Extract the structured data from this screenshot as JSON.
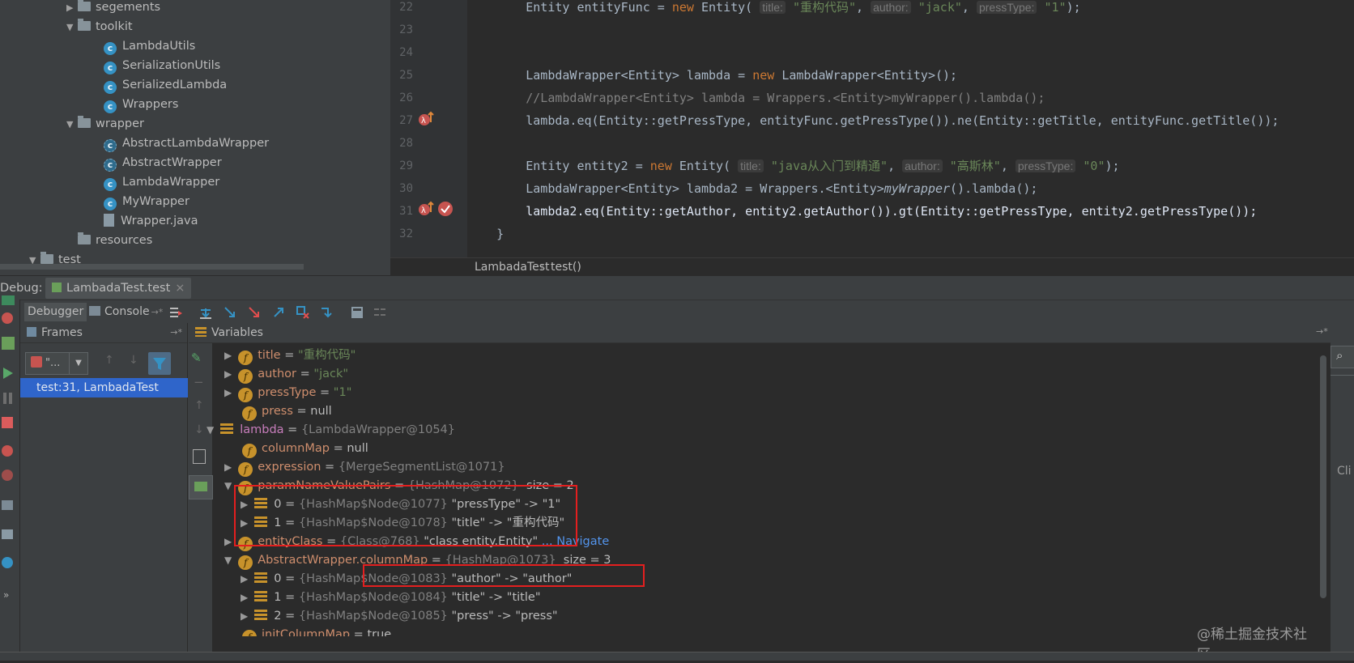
{
  "tree": [
    {
      "label": "segements",
      "type": "folder",
      "expanded": false
    },
    {
      "label": "toolkit",
      "type": "folder",
      "expanded": true
    },
    {
      "label": "LambdaUtils",
      "type": "class"
    },
    {
      "label": "SerializationUtils",
      "type": "class"
    },
    {
      "label": "SerializedLambda",
      "type": "class"
    },
    {
      "label": "Wrappers",
      "type": "class"
    },
    {
      "label": "wrapper",
      "type": "folder",
      "expanded": true
    },
    {
      "label": "AbstractLambdaWrapper",
      "type": "abstract"
    },
    {
      "label": "AbstractWrapper",
      "type": "abstract"
    },
    {
      "label": "LambdaWrapper",
      "type": "class"
    },
    {
      "label": "MyWrapper",
      "type": "class"
    },
    {
      "label": "Wrapper.java",
      "type": "file"
    },
    {
      "label": "resources",
      "type": "folder",
      "expanded": null
    },
    {
      "label": "test",
      "type": "folder",
      "expanded": true
    }
  ],
  "editor": {
    "line_numbers": [
      "22",
      "23",
      "24",
      "25",
      "26",
      "27",
      "28",
      "29",
      "30",
      "31",
      "32"
    ],
    "breadcrumb": {
      "file": "LambadaTest",
      "method": "test()"
    },
    "highlighted_line": "31"
  },
  "debug": {
    "title_label": "Debug:",
    "tab_label": "LambadaTest.test",
    "debugger_tab": "Debugger",
    "console_tab": "Console",
    "frames_label": "Frames",
    "variables_label": "Variables",
    "frame_item": "test:31, LambadaTest",
    "thread_select": "\"...",
    "right_label": "Cli"
  },
  "variables": [
    {
      "name": "title",
      "value": "\"重构代码\""
    },
    {
      "name": "author",
      "value": "\"jack\""
    },
    {
      "name": "pressType",
      "value": "\"1\""
    },
    {
      "name": "press",
      "value": "null"
    },
    {
      "name": "lambda",
      "value": "{LambdaWrapper@1054}"
    },
    {
      "name": "columnMap",
      "value": "null"
    },
    {
      "name": "expression",
      "value": "{MergeSegmentList@1071}"
    },
    {
      "name": "paramNameValuePairs",
      "ref": "{HashMap@1072}",
      "extra": "size = 2"
    },
    {
      "name": "0",
      "ref": "{HashMap$Node@1077}",
      "extra": "\"pressType\" -> \"1\""
    },
    {
      "name": "1",
      "ref": "{HashMap$Node@1078}",
      "extra": "\"title\" -> \"重构代码\""
    },
    {
      "name": "entityClass",
      "ref": "{Class@768}",
      "extra": "\"class entity.Entity\"",
      "link": "... Navigate"
    },
    {
      "name": "AbstractWrapper.columnMap",
      "ref": "{HashMap@1073}",
      "extra": "size = 3"
    },
    {
      "name": "0",
      "ref": "{HashMap$Node@1083}",
      "extra": "\"author\" -> \"author\""
    },
    {
      "name": "1",
      "ref": "{HashMap$Node@1084}",
      "extra": "\"title\" -> \"title\""
    },
    {
      "name": "2",
      "ref": "{HashMap$Node@1085}",
      "extra": "\"press\" -> \"press\""
    },
    {
      "name": "initColumnMap",
      "value": "true"
    }
  ],
  "watermark": "@稀土掘金技术社区",
  "colors": {
    "highlight": "#2f65ca",
    "annotation_box": "#e41f1f",
    "selected_frame": "#2f65ca"
  }
}
